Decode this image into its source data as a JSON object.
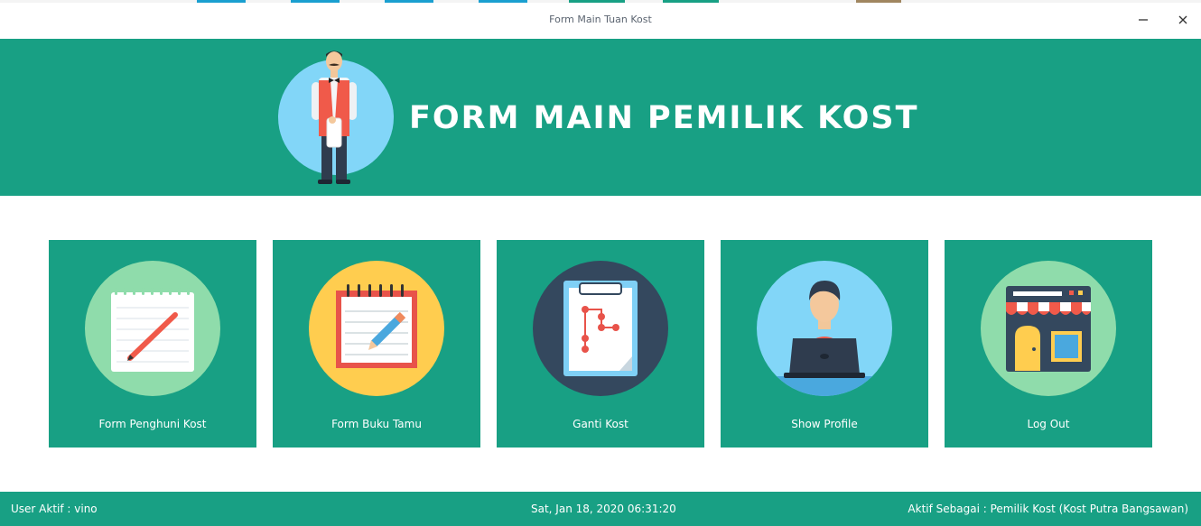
{
  "window": {
    "title": "Form Main Tuan Kost",
    "minimize_icon": "minimize-icon",
    "close_icon": "close-icon"
  },
  "header": {
    "heading": "FORM MAIN PEMILIK KOST",
    "logo_icon": "waiter-avatar-icon",
    "background_color": "#18a084"
  },
  "tiles": [
    {
      "label": "Form Penghuni Kost",
      "icon": "notepad-pencil-icon",
      "circle_color": "#8fdcab"
    },
    {
      "label": "Form Buku Tamu",
      "icon": "guestbook-icon",
      "circle_color": "#ffcd4f"
    },
    {
      "label": "Ganti Kost",
      "icon": "clipboard-flowchart-icon",
      "circle_color": "#34485e"
    },
    {
      "label": "Show Profile",
      "icon": "user-laptop-icon",
      "circle_color": "#82d6f8"
    },
    {
      "label": "Log Out",
      "icon": "storefront-icon",
      "circle_color": "#8fdcab"
    }
  ],
  "status": {
    "user_text": "User Aktif : vino",
    "datetime": "Sat, Jan 18, 2020 06:31:20",
    "role_text": "Aktif Sebagai : Pemilik Kost (Kost Putra Bangsawan)"
  },
  "colors": {
    "accent": "#18a084",
    "tile_text": "#ffffff"
  }
}
